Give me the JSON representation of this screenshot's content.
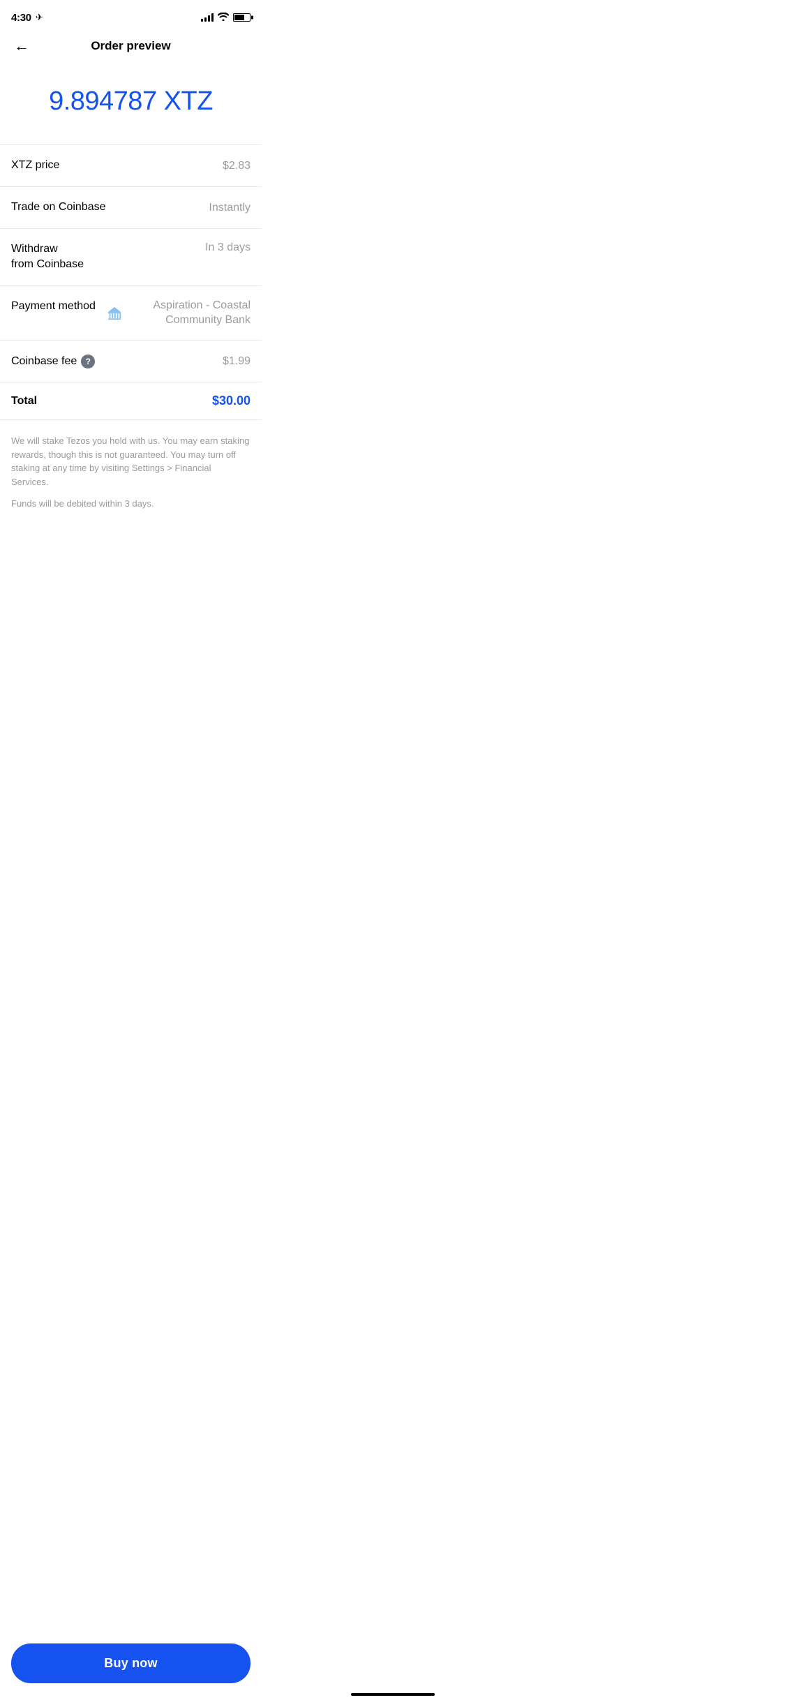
{
  "statusBar": {
    "time": "4:30",
    "locationArrow": "➤"
  },
  "header": {
    "title": "Order preview",
    "backLabel": "←"
  },
  "amount": {
    "value": "9.894787 XTZ",
    "color": "#1652f0"
  },
  "rows": [
    {
      "id": "xtz-price",
      "label": "XTZ price",
      "value": "$2.83",
      "valueColor": "gray"
    },
    {
      "id": "trade-coinbase",
      "label": "Trade on Coinbase",
      "value": "Instantly",
      "valueColor": "gray"
    },
    {
      "id": "withdraw-coinbase",
      "label": "Withdraw\nfrom Coinbase",
      "value": "In 3 days",
      "valueColor": "gray"
    },
    {
      "id": "payment-method",
      "label": "Payment method",
      "value": "Aspiration - Coastal Community Bank",
      "valueColor": "gray"
    }
  ],
  "fee": {
    "label": "Coinbase fee",
    "helpIcon": "?",
    "value": "$1.99"
  },
  "total": {
    "label": "Total",
    "value": "$30.00"
  },
  "disclaimer": {
    "staking": "We will stake Tezos you hold with us. You may earn staking rewards, though this is not guaranteed. You may turn off staking at any time by visiting Settings > Financial Services.",
    "funds": "Funds will be debited within 3 days."
  },
  "buyButton": {
    "label": "Buy now"
  }
}
